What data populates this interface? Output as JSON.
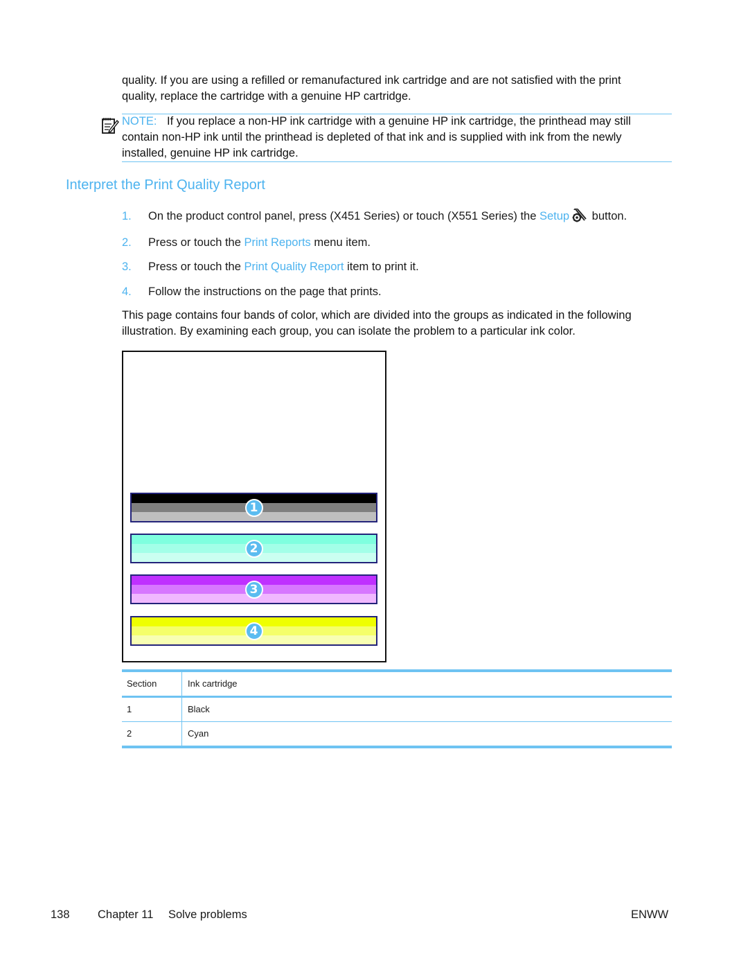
{
  "intro": {
    "line1": "quality. If you are using a refilled or remanufactured ink cartridge and are not satisfied with the print",
    "line2": "quality, replace the cartridge with a genuine HP cartridge."
  },
  "note": {
    "icon": "note-pencil-icon",
    "label": "NOTE:",
    "line1": "If you replace a non-HP ink cartridge with a genuine HP ink cartridge, the printhead may still",
    "line2": "contain non-HP ink until the printhead is depleted of that ink and is supplied with ink from the newly",
    "line3": "installed, genuine HP ink cartridge."
  },
  "section": {
    "heading": "Interpret the Print Quality Report"
  },
  "steps": [
    {
      "num": "1.",
      "before": "On the product control panel, press (X451 Series) or touch (X551 Series) the ",
      "link": "Setup",
      "icon": "setup-wrench-icon",
      "after": " button."
    },
    {
      "num": "2.",
      "before": "Press or touch the ",
      "link": "Print Reports",
      "after": " menu item."
    },
    {
      "num": "3.",
      "before": "Press or touch the ",
      "link": "Print Quality Report",
      "after": " item to print it."
    },
    {
      "num": "4.",
      "before": "Follow the instructions on the page that prints.",
      "link": "",
      "after": ""
    }
  ],
  "description": {
    "line1": "This page contains four bands of color, which are divided into the groups as indicated in the following",
    "line2": "illustration. By examining each group, you can isolate the problem to a particular ink color."
  },
  "figure": {
    "bands": [
      {
        "label": "1",
        "color_name": "black",
        "stripes": [
          "#000000",
          "#7f7f7f",
          "#bfbfbf"
        ]
      },
      {
        "label": "2",
        "color_name": "cyan",
        "stripes": [
          "#7fffdf",
          "#a3ffe8",
          "#cbfff1"
        ]
      },
      {
        "label": "3",
        "color_name": "magenta",
        "stripes": [
          "#bf30ff",
          "#d777ff",
          "#f0b8ff"
        ]
      },
      {
        "label": "4",
        "color_name": "yellow",
        "stripes": [
          "#efff00",
          "#f5ff6a",
          "#f8ffb3"
        ]
      }
    ]
  },
  "table": {
    "headers": [
      "Section",
      "Ink cartridge"
    ],
    "rows": [
      [
        "1",
        "Black"
      ],
      [
        "2",
        "Cyan"
      ]
    ]
  },
  "footer": {
    "page_number": "138",
    "chapter": "Chapter 11",
    "chapter_title": "Solve problems",
    "locale": "ENWW"
  },
  "colors": {
    "accent": "#4db3ef",
    "rule": "#6ec3f2"
  }
}
